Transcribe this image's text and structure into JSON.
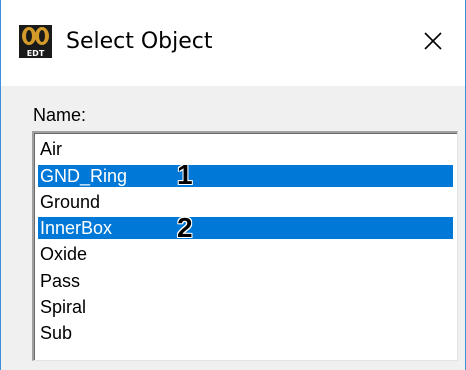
{
  "window": {
    "title": "Select Object",
    "icon": "edt-app-icon",
    "close_icon": "close-icon"
  },
  "name_label": "Name:",
  "list": {
    "items": [
      {
        "label": "Air",
        "selected": false
      },
      {
        "label": "GND_Ring",
        "selected": true
      },
      {
        "label": "Ground",
        "selected": false
      },
      {
        "label": "InnerBox",
        "selected": true
      },
      {
        "label": "Oxide",
        "selected": false
      },
      {
        "label": "Pass",
        "selected": false
      },
      {
        "label": "Spiral",
        "selected": false
      },
      {
        "label": "Sub",
        "selected": false
      }
    ],
    "selection_color": "#0078d7"
  },
  "annotations": [
    {
      "label": "1",
      "item": "GND_Ring"
    },
    {
      "label": "2",
      "item": "InnerBox"
    }
  ]
}
